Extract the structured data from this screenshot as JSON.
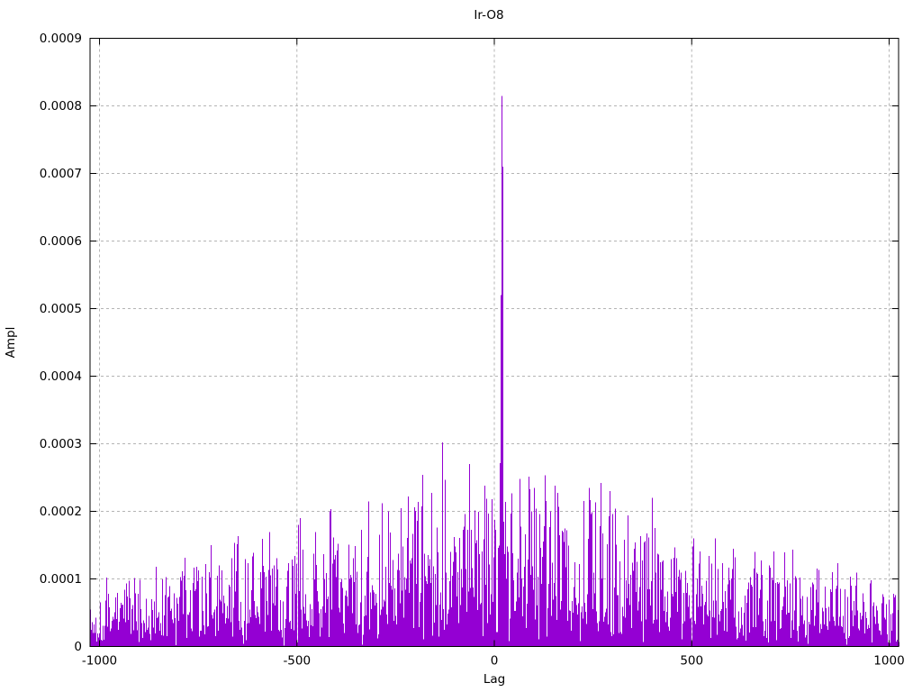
{
  "window": {
    "background": "#ffffff"
  },
  "chart_data": {
    "type": "impulses",
    "title": "Ir-O8",
    "xlabel": "Lag",
    "ylabel": "Ampl",
    "xlim": [
      -1024,
      1024
    ],
    "ylim": [
      0,
      0.0009
    ],
    "xticks": [
      {
        "value": -1000,
        "label": "-1000"
      },
      {
        "value": -500,
        "label": "-500"
      },
      {
        "value": 0,
        "label": "0"
      },
      {
        "value": 500,
        "label": "500"
      },
      {
        "value": 1000,
        "label": "1000"
      }
    ],
    "yticks": [
      {
        "value": 0.0,
        "label": "0"
      },
      {
        "value": 0.0001,
        "label": "0.0001"
      },
      {
        "value": 0.0002,
        "label": "0.0002"
      },
      {
        "value": 0.0003,
        "label": "0.0003"
      },
      {
        "value": 0.0004,
        "label": "0.0004"
      },
      {
        "value": 0.0005,
        "label": "0.0005"
      },
      {
        "value": 0.0006,
        "label": "0.0006"
      },
      {
        "value": 0.0007,
        "label": "0.0007"
      },
      {
        "value": 0.0008,
        "label": "0.0008"
      },
      {
        "value": 0.0009,
        "label": "0.0009"
      }
    ],
    "grid": {
      "visible": true,
      "style": "dashed",
      "color": "#b4b4b4"
    },
    "axis_color": "#000000",
    "text_color": "#000000",
    "legend": "none",
    "series": [
      {
        "name": "Ir-O8",
        "style": "impulses",
        "color": "#9400d3",
        "lag_start": -1024,
        "lag_end": 1023,
        "n_points": 2048,
        "noise_envelope": {
          "edge_amplitude": 3.3e-05,
          "center_amplitude": 9e-05,
          "power": 1.4,
          "seed": 1337
        },
        "peaks": [
          {
            "lag": -497,
            "ampl": 0.00018
          },
          {
            "lag": -417,
            "ampl": 0.0002
          },
          {
            "lag": -319,
            "ampl": 0.000215
          },
          {
            "lag": -269,
            "ampl": 0.0002
          },
          {
            "lag": -133,
            "ampl": 0.000302
          },
          {
            "lag": -64,
            "ampl": 0.00027
          },
          {
            "lag": 17,
            "ampl": 0.00052
          },
          {
            "lag": 18,
            "ampl": 0.000815
          },
          {
            "lag": 19,
            "ampl": 0.000715
          },
          {
            "lag": 20,
            "ampl": 0.00071
          },
          {
            "lag": 100,
            "ampl": 0.000235
          },
          {
            "lag": 240,
            "ampl": 0.000235
          },
          {
            "lag": 398,
            "ampl": 0.00022
          },
          {
            "lag": 505,
            "ampl": 0.00016
          },
          {
            "lag": 601,
            "ampl": 0.000115
          },
          {
            "lag": 856,
            "ampl": 0.00011
          }
        ]
      }
    ]
  }
}
